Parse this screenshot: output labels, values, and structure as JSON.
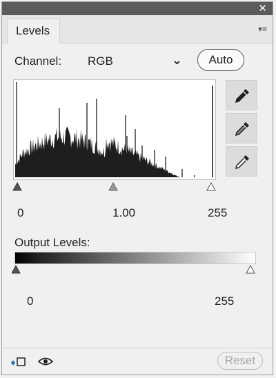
{
  "panel": {
    "tab_label": "Levels",
    "close_glyph": "✕",
    "menu_glyph": "▾≡"
  },
  "channel": {
    "label": "Channel:",
    "value": "RGB",
    "auto_label": "Auto"
  },
  "input_levels": {
    "black": "0",
    "gamma": "1.00",
    "white": "255"
  },
  "output_levels": {
    "label": "Output Levels:",
    "black": "0",
    "white": "255"
  },
  "footer": {
    "reset_label": "Reset"
  },
  "icons": [
    "close-icon",
    "panel-menu-icon",
    "eyedropper-black-icon",
    "eyedropper-gray-icon",
    "eyedropper-white-icon",
    "clip-to-layer-icon",
    "visibility-eye-icon"
  ],
  "colors": {
    "titlebar": "#5c5c5c",
    "panel_bg": "#f0f0f0",
    "histogram_fill": "#1e1e1e",
    "disabled_text": "#a9a9a9"
  }
}
